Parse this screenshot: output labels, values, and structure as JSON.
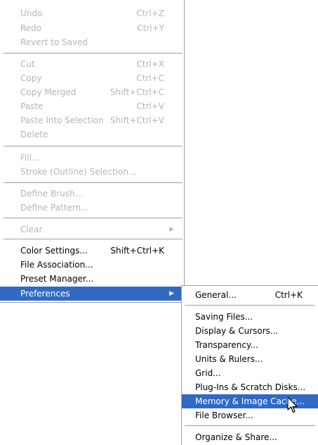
{
  "edit_menu": {
    "undo": "Undo",
    "undo_shortcut": "Ctrl+Z",
    "redo": "Redo",
    "redo_shortcut": "Ctrl+Y",
    "revert": "Revert to Saved",
    "cut": "Cut",
    "cut_shortcut": "Ctrl+X",
    "copy": "Copy",
    "copy_shortcut": "Ctrl+C",
    "copy_merged": "Copy Merged",
    "copy_merged_shortcut": "Shift+Ctrl+C",
    "paste": "Paste",
    "paste_shortcut": "Ctrl+V",
    "paste_into": "Paste Into Selection",
    "paste_into_shortcut": "Shift+Ctrl+V",
    "delete": "Delete",
    "fill": "Fill...",
    "stroke": "Stroke (Outline) Selection...",
    "define_brush": "Define Brush...",
    "define_pattern": "Define Pattern...",
    "clear": "Clear",
    "color_settings": "Color Settings...",
    "color_settings_shortcut": "Shift+Ctrl+K",
    "file_association": "File Association...",
    "preset_manager": "Preset Manager...",
    "preferences": "Preferences"
  },
  "preferences_menu": {
    "general": "General...",
    "general_shortcut": "Ctrl+K",
    "saving_files": "Saving Files...",
    "display_cursors": "Display & Cursors...",
    "transparency": "Transparency...",
    "units_rulers": "Units & Rulers...",
    "grid": "Grid...",
    "plugins_scratch": "Plug-Ins & Scratch Disks...",
    "memory_cache": "Memory & Image Cache...",
    "file_browser": "File Browser...",
    "organize_share": "Organize & Share..."
  },
  "colors": {
    "highlight": "#316ac5",
    "disabled_text": "#b5b5b5"
  }
}
